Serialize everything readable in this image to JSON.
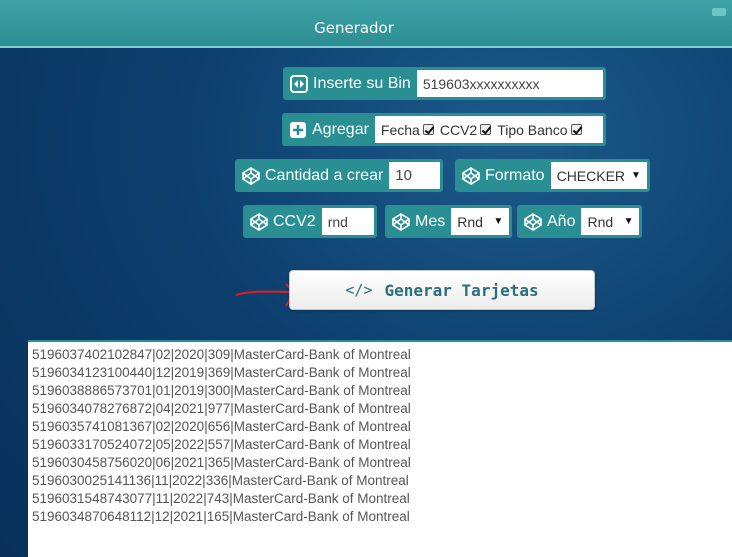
{
  "header": {
    "title": "Generador"
  },
  "bin": {
    "label": "Inserte su Bin",
    "value": "519603xxxxxxxxxx"
  },
  "agregar": {
    "label": "Agregar",
    "options": [
      {
        "label": "Fecha",
        "checked": true
      },
      {
        "label": "CCV2",
        "checked": true
      },
      {
        "label": "Tipo Banco",
        "checked": true
      }
    ]
  },
  "cantidad": {
    "label": "Cantidad a crear",
    "value": "10"
  },
  "formato": {
    "label": "Formato",
    "selected": "CHECKER"
  },
  "ccv2": {
    "label": "CCV2",
    "value": "rnd"
  },
  "mes": {
    "label": "Mes",
    "selected": "Rnd"
  },
  "anio": {
    "label": "Año",
    "selected": "Rnd"
  },
  "generate_button": {
    "label": "Generar Tarjetas",
    "icon": "code-icon"
  },
  "output_lines": [
    "5196037402102847|02|2020|309|MasterCard-Bank of Montreal",
    "5196034123100440|12|2019|369|MasterCard-Bank of Montreal",
    "5196038886573701|01|2019|300|MasterCard-Bank of Montreal",
    "5196034078276872|04|2021|977|MasterCard-Bank of Montreal",
    "5196035741081367|02|2020|656|MasterCard-Bank of Montreal",
    "5196033170524072|05|2022|557|MasterCard-Bank of Montreal",
    "5196030458756020|06|2021|365|MasterCard-Bank of Montreal",
    "5196030025141136|11|2022|336|MasterCard-Bank of Montreal",
    "5196031548743077|11|2022|743|MasterCard-Bank of Montreal",
    "5196034870648112|12|2021|165|MasterCard-Bank of Montreal"
  ],
  "colors": {
    "accent": "#2a8f92",
    "background": "#0c3f6e",
    "annotation_arrow": "#e02020"
  }
}
